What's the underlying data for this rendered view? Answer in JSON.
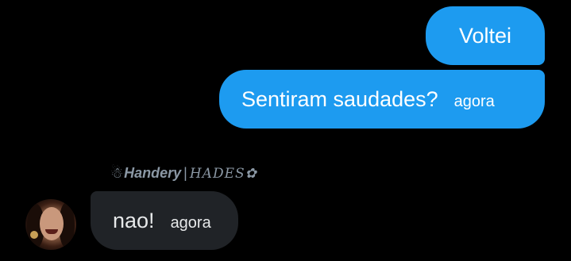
{
  "theme": {
    "accent": "#1d9bf0",
    "background": "#000000",
    "incoming_bubble": "#202327"
  },
  "messages": [
    {
      "direction": "outgoing",
      "text": "Voltei",
      "time": ""
    },
    {
      "direction": "outgoing",
      "text": "Sentiram saudades?",
      "time": "agora"
    },
    {
      "direction": "incoming",
      "text": "nao!",
      "time": "agora"
    }
  ],
  "sender": {
    "glyph": "☃",
    "name": "Handery",
    "separator": "|",
    "alt_name": "HADES✿"
  },
  "icons": {
    "avatar": "user-avatar-photo"
  }
}
